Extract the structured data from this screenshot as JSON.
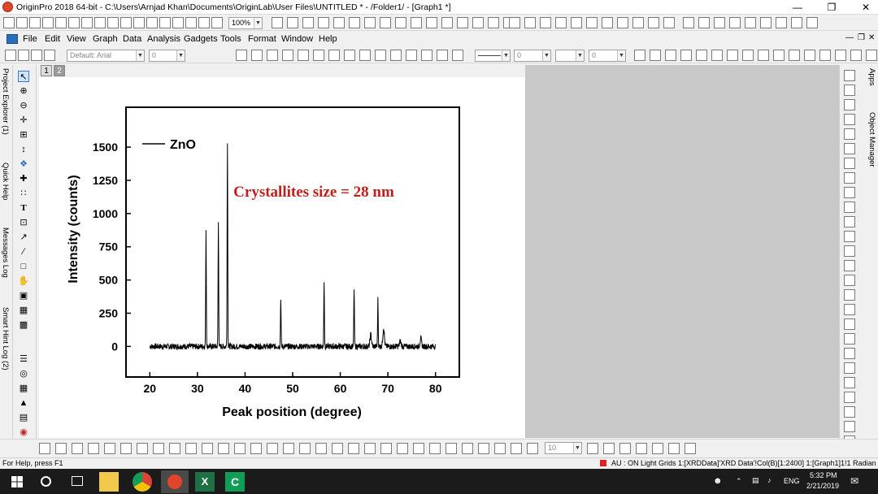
{
  "window": {
    "title": "OriginPro 2018 64-bit - C:\\Users\\Arnjad Khan\\Documents\\OriginLab\\User Files\\UNTITLED * - /Folder1/ - [Graph1 *]"
  },
  "toolbar": {
    "zoom_value": "100%"
  },
  "menu": [
    "File",
    "Edit",
    "View",
    "Graph",
    "Data",
    "Analysis",
    "Gadgets",
    "Tools",
    "Format",
    "Window",
    "Help"
  ],
  "format_toolbar": {
    "font_name": "Default: Arial",
    "font_size": "0",
    "bold": "B",
    "italic": "I",
    "underline": "U",
    "line_width_1": "0",
    "line_width_2": "0"
  },
  "left_dock_tabs": [
    "Project Explorer (1)",
    "Quick Help",
    "Messages Log",
    "Smart Hint Log (2)"
  ],
  "right_dock_tabs": [
    "Apps",
    "Object Manager"
  ],
  "layer_tabs": [
    "1",
    "2"
  ],
  "chart_data": {
    "type": "line",
    "xlabel": "Peak position (degree)",
    "ylabel": "Intensity (counts)",
    "xlim": [
      15,
      85
    ],
    "ylim": [
      -230,
      1800
    ],
    "xticks": [
      20,
      30,
      40,
      50,
      60,
      70,
      80
    ],
    "yticks": [
      0,
      250,
      500,
      750,
      1000,
      1250,
      1500
    ],
    "series": [
      {
        "name": "ZnO",
        "color": "#000000",
        "baseline": 0,
        "peaks": [
          {
            "x": 31.8,
            "y": 880
          },
          {
            "x": 34.4,
            "y": 930
          },
          {
            "x": 36.3,
            "y": 1530
          },
          {
            "x": 47.5,
            "y": 370
          },
          {
            "x": 56.6,
            "y": 495
          },
          {
            "x": 62.9,
            "y": 440
          },
          {
            "x": 66.4,
            "y": 90
          },
          {
            "x": 67.9,
            "y": 355
          },
          {
            "x": 69.1,
            "y": 140
          },
          {
            "x": 72.6,
            "y": 40
          },
          {
            "x": 76.9,
            "y": 60
          }
        ]
      }
    ],
    "legend": {
      "label": "ZnO",
      "position": "top-left"
    },
    "annotation": {
      "text": "Crystallites size = 28 nm",
      "color": "#c0201a"
    }
  },
  "bottom_toolbar": {
    "size_value": "10"
  },
  "statusbar": {
    "left": "For Help, press F1",
    "right": "AU : ON  Light Grids  1:[XRDData]'XRD Data'!Col(B)[1:2400]  1:[Graph1]1!1  Radian"
  },
  "taskbar": {
    "language": "ENG",
    "time": "5:32 PM",
    "date": "2/21/2019"
  }
}
